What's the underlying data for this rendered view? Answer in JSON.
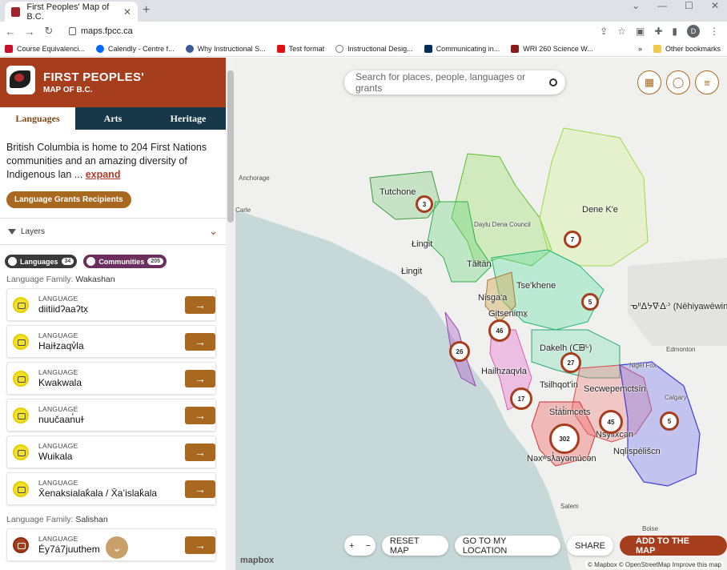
{
  "browser": {
    "tab_title": "First Peoples' Map of B.C.",
    "url": "maps.fpcc.ca",
    "profile_initial": "D",
    "bookmarks": [
      "Course Equivalenci...",
      "Calendly - Centre f...",
      "Why Instructional S...",
      "Test format",
      "Instructional Desig...",
      "Communicating in...",
      "WRI 260 Science W..."
    ],
    "bookmarks_more": "»",
    "other_bookmarks": "Other bookmarks"
  },
  "sidebar": {
    "brand_line1": "FIRST PEOPLES'",
    "brand_line2": "MAP OF B.C.",
    "tabs": [
      "Languages",
      "Arts",
      "Heritage"
    ],
    "intro_text": "British Columbia is home to 204 First Nations communities and an amazing diversity of Indigenous lan ... ",
    "expand_link": "expand",
    "grants_button": "Language Grants Recipients",
    "layers_label": "Layers",
    "filter_languages": "Languages",
    "filter_languages_count": "34",
    "filter_communities": "Communities",
    "filter_communities_count": "205",
    "family_prefix": "Language Family:",
    "family1": "Wakashan",
    "family2": "Salishan",
    "card_kicker": "LANGUAGE",
    "languages": [
      "diitiidʔaaʔtx̣",
      "Haiɫzaqv̓la",
      "Kwakwala",
      "nuučaan̓uɫ",
      "Wuikala",
      "X̄enaksialak̓ala / X̄a’islak̓ala",
      "Éy7á7juuthem"
    ]
  },
  "map": {
    "search_placeholder": "Search for places, people, languages or grants",
    "labels": [
      "Tutchone",
      "Daylu Dena Council",
      "Dene K'e",
      "Łingit",
      "Łingit",
      "Tāłtān",
      "Nisg̱a'a",
      "Tse'khene",
      "Gitsenimx̱",
      "ᓀᐦᐃᔭᐍᐏᐣ (Nēhiyawēwin)",
      "Dakelh (ᑕᗸᒡ)",
      "Hailhzaqvla",
      "Tsilhqot'in",
      "Secwepemctsín",
      "Nigel Fox",
      "Edmonton",
      "Calgary",
      "St̓át̓imcets",
      "Nsyilxcən",
      "Nqlispélišcn",
      "Nəxʷsƛ̓ayəmúcən",
      "Anchorage",
      "Carle",
      "Salem",
      "Boise"
    ],
    "clusters": [
      "3",
      "7",
      "5",
      "46",
      "26",
      "27",
      "17",
      "45",
      "5",
      "302"
    ],
    "zoom_in": "+",
    "zoom_out": "−",
    "reset": "RESET MAP",
    "locate": "GO TO MY LOCATION",
    "share": "SHARE",
    "add": "ADD TO THE MAP",
    "mapbox": "mapbox",
    "attribution": "© Mapbox © OpenStreetMap Improve this map"
  },
  "colors": {
    "brand": "#a63d1d",
    "navy": "#163849",
    "gold": "#a8681f"
  }
}
